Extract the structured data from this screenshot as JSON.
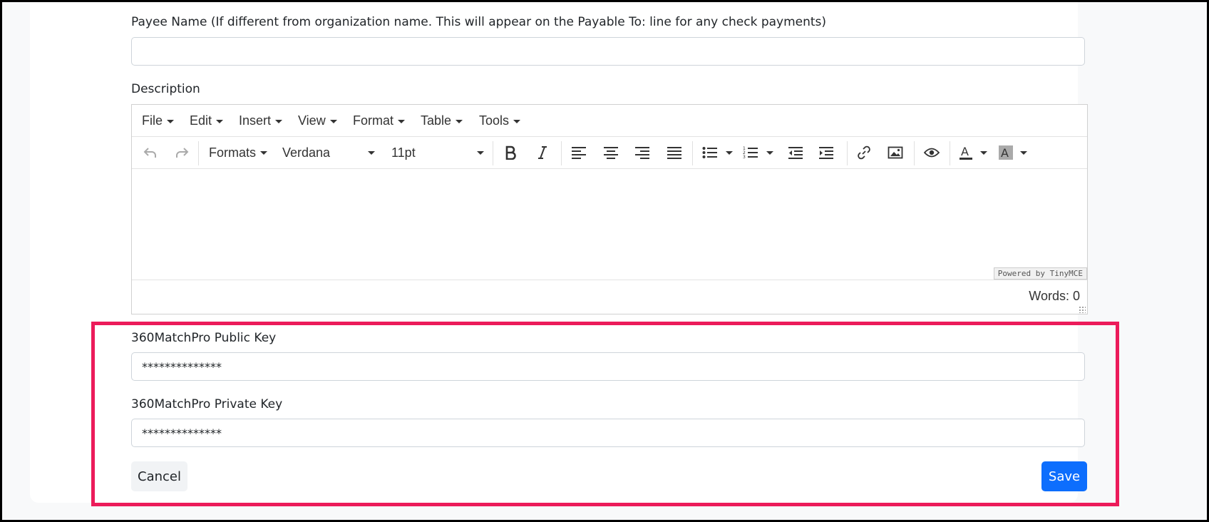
{
  "payee": {
    "label": "Payee Name (If different from organization name. This will appear on the Payable To: line for any check payments)",
    "value": ""
  },
  "description": {
    "label": "Description",
    "menus": [
      "File",
      "Edit",
      "Insert",
      "View",
      "Format",
      "Table",
      "Tools"
    ],
    "toolbar": {
      "formats": "Formats",
      "font_family": "Verdana",
      "font_size": "11pt"
    },
    "powered_by": "Powered by TinyMCE",
    "word_count": "Words: 0"
  },
  "public_key": {
    "label": "360MatchPro Public Key",
    "value": "**************"
  },
  "private_key": {
    "label": "360MatchPro Private Key",
    "value": "**************"
  },
  "buttons": {
    "cancel": "Cancel",
    "save": "Save"
  },
  "colors": {
    "highlight": "#ec1b5a",
    "primary": "#0d6efd"
  }
}
